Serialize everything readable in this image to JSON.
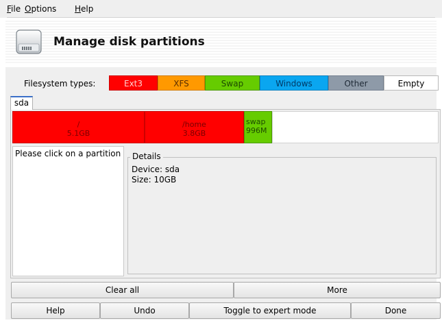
{
  "menu": {
    "items": [
      {
        "underline": "F",
        "rest": "ile"
      },
      {
        "underline": "O",
        "rest": "ptions"
      },
      {
        "underline": "H",
        "rest": "elp"
      }
    ]
  },
  "header": {
    "title": "Manage disk partitions",
    "icon": "hard-disk-icon"
  },
  "filesystem_types": {
    "label": "Filesystem types:",
    "types": [
      {
        "label": "Ext3",
        "color": "#ff0000",
        "text_color": "#ffd0d0"
      },
      {
        "label": "XFS",
        "color": "#ff9900",
        "text_color": "#5a2e00"
      },
      {
        "label": "Swap",
        "color": "#66cc00",
        "text_color": "#1d4a00"
      },
      {
        "label": "Windows",
        "color": "#0aa6f0",
        "text_color": "#003a66"
      },
      {
        "label": "Other",
        "color": "#8e9aa8",
        "text_color": "#1f2a36"
      },
      {
        "label": "Empty",
        "color": "#ffffff",
        "text_color": "#000000"
      }
    ]
  },
  "tabs": [
    {
      "label": "sda"
    }
  ],
  "partitions": [
    {
      "mount": "/",
      "size": "5.1GB",
      "color": "#ff0000"
    },
    {
      "mount": "/home",
      "size": "3.8GB",
      "color": "#ff0000"
    },
    {
      "mount": "swap",
      "size": "996M",
      "color": "#66cc00"
    }
  ],
  "partition_list": {
    "hint": "Please click on a partition"
  },
  "details": {
    "legend": "Details",
    "device": "Device: sda",
    "size": "Size: 10GB"
  },
  "buttons": {
    "clear_all": "Clear all",
    "more": "More",
    "help": "Help",
    "undo": "Undo",
    "toggle_expert": "Toggle to expert mode",
    "done": "Done"
  }
}
